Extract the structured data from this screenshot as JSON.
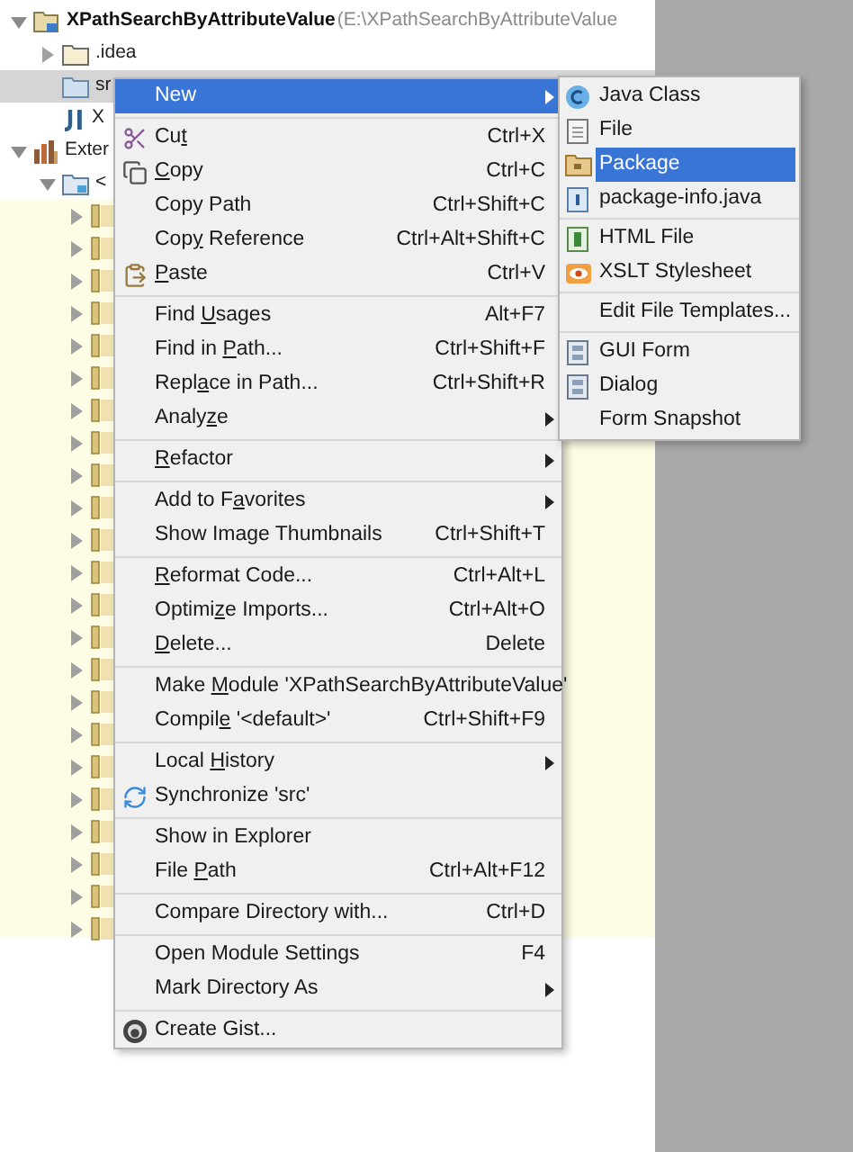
{
  "tree": [
    {
      "kind": "module",
      "label": "XPathSearchByAttributeValue",
      "path": "(E:\\XPathSearchByAttributeValue",
      "expanded": true,
      "selected": false,
      "children": [
        {
          "kind": "folder",
          "label": ".idea",
          "expanded": false,
          "selected": false
        },
        {
          "kind": "source-folder",
          "label": "sr",
          "selected": true
        },
        {
          "kind": "iml",
          "label": "X",
          "selected": false
        }
      ]
    },
    {
      "kind": "libraries",
      "label": "Exter",
      "expanded": true,
      "selected": false,
      "children": [
        {
          "kind": "jdk",
          "label": "<",
          "expanded": true,
          "selected": false,
          "children": [
            {
              "kind": "jar",
              "expanded": false,
              "selected": false
            },
            {
              "kind": "jar",
              "expanded": false,
              "selected": false
            },
            {
              "kind": "jar",
              "expanded": false,
              "selected": false
            },
            {
              "kind": "jar",
              "expanded": false,
              "selected": false
            },
            {
              "kind": "jar",
              "expanded": false,
              "selected": false
            },
            {
              "kind": "jar",
              "expanded": false,
              "selected": false
            },
            {
              "kind": "jar",
              "expanded": false,
              "selected": false
            },
            {
              "kind": "jar",
              "expanded": false,
              "selected": false
            },
            {
              "kind": "jar",
              "expanded": false,
              "selected": false
            },
            {
              "kind": "jar",
              "expanded": false,
              "selected": false
            },
            {
              "kind": "jar",
              "expanded": false,
              "selected": false
            },
            {
              "kind": "jar",
              "expanded": false,
              "selected": false
            },
            {
              "kind": "jar",
              "expanded": false,
              "selected": false
            },
            {
              "kind": "jar",
              "expanded": false,
              "selected": false
            },
            {
              "kind": "jar",
              "expanded": false,
              "selected": false
            },
            {
              "kind": "jar",
              "expanded": false,
              "selected": false
            },
            {
              "kind": "jar",
              "expanded": false,
              "selected": false
            },
            {
              "kind": "jar",
              "expanded": false,
              "selected": false
            },
            {
              "kind": "jar",
              "expanded": false,
              "selected": false
            },
            {
              "kind": "jar",
              "expanded": false,
              "selected": false
            },
            {
              "kind": "jar",
              "expanded": false,
              "selected": false
            },
            {
              "kind": "jar",
              "expanded": false,
              "selected": false
            },
            {
              "kind": "jar",
              "expanded": false,
              "selected": false
            }
          ]
        }
      ]
    }
  ],
  "context_menu": {
    "groups": [
      [
        {
          "label": [
            {
              "text": "New"
            }
          ],
          "kind": "plain",
          "submenu": true,
          "selected": true
        }
      ],
      [
        {
          "label": [
            {
              "text": "Cu"
            },
            {
              "text": "t",
              "underline": true
            }
          ],
          "shortcut": "Ctrl+X",
          "kind": "cut",
          "submenu": false,
          "selected": false
        },
        {
          "label": [
            {
              "text": "C",
              "underline": true
            },
            {
              "text": "opy"
            }
          ],
          "shortcut": "Ctrl+C",
          "kind": "copy",
          "submenu": false,
          "selected": false
        },
        {
          "label": [
            {
              "text": "Copy Path"
            }
          ],
          "shortcut": "Ctrl+Shift+C",
          "kind": "plain",
          "submenu": false,
          "selected": false
        },
        {
          "label": [
            {
              "text": "Cop"
            },
            {
              "text": "y",
              "underline": true
            },
            {
              "text": " Reference"
            }
          ],
          "shortcut": "Ctrl+Alt+Shift+C",
          "kind": "plain",
          "submenu": false,
          "selected": false
        },
        {
          "label": [
            {
              "text": "P",
              "underline": true
            },
            {
              "text": "aste"
            }
          ],
          "shortcut": "Ctrl+V",
          "kind": "paste",
          "submenu": false,
          "selected": false
        }
      ],
      [
        {
          "label": [
            {
              "text": "Find "
            },
            {
              "text": "U",
              "underline": true
            },
            {
              "text": "sages"
            }
          ],
          "shortcut": "Alt+F7",
          "kind": "plain",
          "submenu": false,
          "selected": false
        },
        {
          "label": [
            {
              "text": "Find in "
            },
            {
              "text": "P",
              "underline": true
            },
            {
              "text": "ath..."
            }
          ],
          "shortcut": "Ctrl+Shift+F",
          "kind": "plain",
          "submenu": false,
          "selected": false
        },
        {
          "label": [
            {
              "text": "Repl"
            },
            {
              "text": "a",
              "underline": true
            },
            {
              "text": "ce in Path..."
            }
          ],
          "shortcut": "Ctrl+Shift+R",
          "kind": "plain",
          "submenu": false,
          "selected": false
        },
        {
          "label": [
            {
              "text": "Analy"
            },
            {
              "text": "z",
              "underline": true
            },
            {
              "text": "e"
            }
          ],
          "kind": "plain",
          "submenu": true,
          "selected": false
        }
      ],
      [
        {
          "label": [
            {
              "text": "R",
              "underline": true
            },
            {
              "text": "efactor"
            }
          ],
          "kind": "plain",
          "submenu": true,
          "selected": false
        }
      ],
      [
        {
          "label": [
            {
              "text": "Add to F"
            },
            {
              "text": "a",
              "underline": true
            },
            {
              "text": "vorites"
            }
          ],
          "kind": "plain",
          "submenu": true,
          "selected": false
        },
        {
          "label": [
            {
              "text": "Show Image Thumbnails"
            }
          ],
          "shortcut": "Ctrl+Shift+T",
          "kind": "plain",
          "submenu": false,
          "selected": false
        }
      ],
      [
        {
          "label": [
            {
              "text": "R",
              "underline": true
            },
            {
              "text": "eformat Code..."
            }
          ],
          "shortcut": "Ctrl+Alt+L",
          "kind": "plain",
          "submenu": false,
          "selected": false
        },
        {
          "label": [
            {
              "text": "Optimi"
            },
            {
              "text": "z",
              "underline": true
            },
            {
              "text": "e Imports..."
            }
          ],
          "shortcut": "Ctrl+Alt+O",
          "kind": "plain",
          "submenu": false,
          "selected": false
        },
        {
          "label": [
            {
              "text": "D",
              "underline": true
            },
            {
              "text": "elete..."
            }
          ],
          "shortcut": "Delete",
          "kind": "plain",
          "submenu": false,
          "selected": false
        }
      ],
      [
        {
          "label": [
            {
              "text": "Make "
            },
            {
              "text": "M",
              "underline": true
            },
            {
              "text": "odule 'XPathSearchByAttributeValue'"
            }
          ],
          "kind": "plain",
          "submenu": false,
          "selected": false
        },
        {
          "label": [
            {
              "text": "Compil"
            },
            {
              "text": "e",
              "underline": true
            },
            {
              "text": " '<default>'"
            }
          ],
          "shortcut": "Ctrl+Shift+F9",
          "kind": "plain",
          "submenu": false,
          "selected": false
        }
      ],
      [
        {
          "label": [
            {
              "text": "Local "
            },
            {
              "text": "H",
              "underline": true
            },
            {
              "text": "istory"
            }
          ],
          "kind": "plain",
          "submenu": true,
          "selected": false
        },
        {
          "label": [
            {
              "text": "Synchronize 'src'"
            }
          ],
          "kind": "sync",
          "submenu": false,
          "selected": false
        }
      ],
      [
        {
          "label": [
            {
              "text": "Show in Explorer"
            }
          ],
          "kind": "plain",
          "submenu": false,
          "selected": false
        },
        {
          "label": [
            {
              "text": "File "
            },
            {
              "text": "P",
              "underline": true
            },
            {
              "text": "ath"
            }
          ],
          "shortcut": "Ctrl+Alt+F12",
          "kind": "plain",
          "submenu": false,
          "selected": false
        }
      ],
      [
        {
          "label": [
            {
              "text": "Compare Directory with..."
            }
          ],
          "shortcut": "Ctrl+D",
          "kind": "plain",
          "submenu": false,
          "selected": false
        }
      ],
      [
        {
          "label": [
            {
              "text": "Open Module Settings"
            }
          ],
          "shortcut": "F4",
          "kind": "plain",
          "submenu": false,
          "selected": false
        },
        {
          "label": [
            {
              "text": "Mark Directory As"
            }
          ],
          "kind": "plain",
          "submenu": true,
          "selected": false
        }
      ],
      [
        {
          "label": [
            {
              "text": "Create Gist..."
            }
          ],
          "kind": "gist",
          "submenu": false,
          "selected": false
        }
      ]
    ]
  },
  "new_submenu": {
    "groups": [
      [
        {
          "label": "Java Class",
          "kind": "java-class",
          "selected": false
        },
        {
          "label": "File",
          "kind": "file",
          "selected": false
        },
        {
          "label": "Package",
          "kind": "package",
          "selected": true
        },
        {
          "label": "package-info.java",
          "kind": "package-info",
          "selected": false
        }
      ],
      [
        {
          "label": "HTML File",
          "kind": "html",
          "selected": false
        },
        {
          "label": "XSLT Stylesheet",
          "kind": "xslt",
          "selected": false
        }
      ],
      [
        {
          "label": "Edit File Templates...",
          "kind": "plain",
          "selected": false
        }
      ],
      [
        {
          "label": "GUI Form",
          "kind": "form",
          "selected": false
        },
        {
          "label": "Dialog",
          "kind": "form",
          "selected": false
        },
        {
          "label": "Form Snapshot",
          "kind": "plain",
          "selected": false
        }
      ]
    ]
  }
}
